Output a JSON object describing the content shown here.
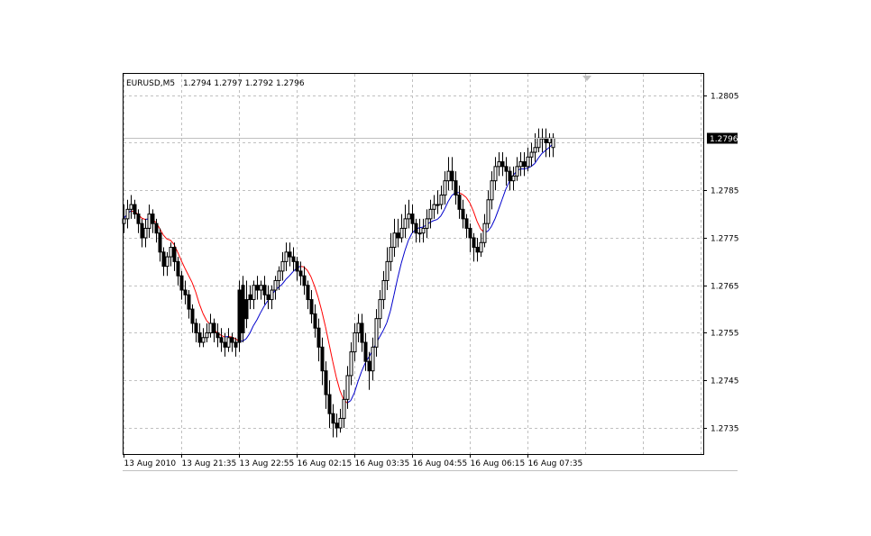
{
  "header": {
    "symbol": "EURUSD,M5",
    "ohlc": "1.2794 1.2797 1.2792 1.2796"
  },
  "current_price_label": "1.2796",
  "colors": {
    "background": "#ffffff",
    "grid": "#c0c0c0",
    "candle": "#000000",
    "ma_up": "#0000cc",
    "ma_down": "#ff0000",
    "marker": "#c0c0c0"
  },
  "chart_data": {
    "type": "candlestick",
    "title": "",
    "xlabel": "",
    "ylabel": "",
    "ylim": [
      1.27295,
      1.28095
    ],
    "grid": true,
    "y_ticks": [
      1.2735,
      1.2745,
      1.2755,
      1.2765,
      1.2775,
      1.2785,
      1.2795,
      1.2805
    ],
    "y_tick_labels": [
      "1.2735",
      "1.2745",
      "1.2755",
      "1.2765",
      "1.2775",
      "1.2785",
      "1.2805"
    ],
    "x_tick_labels": [
      "13 Aug 2010",
      "13 Aug 21:35",
      "13 Aug 22:55",
      "16 Aug 02:15",
      "16 Aug 03:35",
      "16 Aug 04:55",
      "16 Aug 06:15",
      "16 Aug 07:35"
    ],
    "x_tick_bars": [
      0,
      16,
      32,
      48,
      64,
      80,
      96,
      112
    ],
    "candles": {
      "close": [
        1.2779,
        1.2781,
        1.2782,
        1.278,
        1.2778,
        1.2775,
        1.2777,
        1.278,
        1.2778,
        1.2776,
        1.2772,
        1.2769,
        1.2771,
        1.2773,
        1.277,
        1.2767,
        1.2764,
        1.2763,
        1.276,
        1.2757,
        1.2755,
        1.2753,
        1.2754,
        1.2755,
        1.2757,
        1.2755,
        1.2754,
        1.2753,
        1.2752,
        1.2754,
        1.2753,
        1.2752,
        1.2753,
        1.2755,
        1.2758,
        1.2762,
        1.2765,
        1.2764,
        1.2765,
        1.2763,
        1.2762,
        1.2764,
        1.2766,
        1.2768,
        1.277,
        1.2772,
        1.2771,
        1.277,
        1.2768,
        1.2767,
        1.2765,
        1.2762,
        1.2759,
        1.2756,
        1.2752,
        1.2747,
        1.2742,
        1.2738,
        1.2736,
        1.2735,
        1.2737,
        1.2741,
        1.2746,
        1.2751,
        1.2755,
        1.2757,
        1.2753,
        1.2749,
        1.2747,
        1.2752,
        1.2758,
        1.2762,
        1.2766,
        1.277,
        1.2773,
        1.2776,
        1.2775,
        1.2777,
        1.2779,
        1.278,
        1.2778,
        1.2776,
        1.2776,
        1.2777,
        1.2779,
        1.2781,
        1.2782,
        1.2782,
        1.2784,
        1.2787,
        1.2789,
        1.2787,
        1.2784,
        1.2781,
        1.2779,
        1.2777,
        1.2775,
        1.2773,
        1.2772,
        1.2774,
        1.2778,
        1.2783,
        1.2787,
        1.279,
        1.2791,
        1.279,
        1.2789,
        1.2787,
        1.2788,
        1.279,
        1.2791,
        1.279,
        1.2792,
        1.2793,
        1.2794,
        1.2796,
        1.2796,
        1.2795,
        1.2796,
        1.2796
      ],
      "open": [
        1.2778,
        1.2779,
        1.2781,
        1.2782,
        1.278,
        1.2778,
        1.2775,
        1.2777,
        1.278,
        1.2778,
        1.2776,
        1.2772,
        1.2769,
        1.2771,
        1.2773,
        1.277,
        1.2767,
        1.2764,
        1.2763,
        1.276,
        1.2757,
        1.2755,
        1.2753,
        1.2754,
        1.2755,
        1.2757,
        1.2755,
        1.2754,
        1.2753,
        1.2752,
        1.2754,
        1.2753,
        1.2764,
        1.2765,
        1.2762,
        1.2763,
        1.2762,
        1.2765,
        1.2764,
        1.2765,
        1.2763,
        1.2762,
        1.2764,
        1.2766,
        1.2768,
        1.277,
        1.2772,
        1.2771,
        1.277,
        1.2768,
        1.2767,
        1.2765,
        1.2762,
        1.2759,
        1.2756,
        1.2752,
        1.2747,
        1.2742,
        1.2738,
        1.2736,
        1.2735,
        1.2737,
        1.2741,
        1.2746,
        1.2751,
        1.2755,
        1.2757,
        1.2753,
        1.2749,
        1.2747,
        1.2752,
        1.2758,
        1.2762,
        1.2766,
        1.277,
        1.2773,
        1.2776,
        1.2775,
        1.2777,
        1.2779,
        1.278,
        1.2778,
        1.2776,
        1.2776,
        1.2777,
        1.2779,
        1.2781,
        1.2782,
        1.2782,
        1.2784,
        1.2787,
        1.2789,
        1.2787,
        1.2784,
        1.2781,
        1.2779,
        1.2777,
        1.2775,
        1.2773,
        1.2772,
        1.2774,
        1.2778,
        1.2783,
        1.2787,
        1.279,
        1.2791,
        1.279,
        1.2789,
        1.2787,
        1.2788,
        1.279,
        1.2791,
        1.279,
        1.2792,
        1.2793,
        1.2794,
        1.2796,
        1.2796,
        1.2795,
        1.2794
      ],
      "high": [
        1.2782,
        1.2783,
        1.2784,
        1.2783,
        1.2781,
        1.2779,
        1.2779,
        1.2782,
        1.2781,
        1.2779,
        1.2777,
        1.2773,
        1.2772,
        1.2774,
        1.2774,
        1.2771,
        1.2768,
        1.2766,
        1.2764,
        1.2761,
        1.2758,
        1.2757,
        1.2756,
        1.2757,
        1.2759,
        1.2758,
        1.2757,
        1.2756,
        1.2755,
        1.2756,
        1.2755,
        1.2754,
        1.2766,
        1.2767,
        1.2766,
        1.2765,
        1.2766,
        1.2767,
        1.2766,
        1.2767,
        1.2765,
        1.2765,
        1.2767,
        1.2769,
        1.2772,
        1.2774,
        1.2774,
        1.2773,
        1.2771,
        1.277,
        1.2769,
        1.2766,
        1.2764,
        1.2761,
        1.2758,
        1.2754,
        1.2749,
        1.2745,
        1.274,
        1.2738,
        1.2739,
        1.2743,
        1.2748,
        1.2753,
        1.2757,
        1.2759,
        1.2759,
        1.2755,
        1.2751,
        1.2754,
        1.276,
        1.2764,
        1.2768,
        1.2773,
        1.2776,
        1.2779,
        1.2779,
        1.278,
        1.2782,
        1.2783,
        1.2782,
        1.2779,
        1.2779,
        1.2779,
        1.2781,
        1.2783,
        1.2784,
        1.2785,
        1.2786,
        1.2789,
        1.2792,
        1.2792,
        1.2789,
        1.2786,
        1.2783,
        1.278,
        1.2778,
        1.2776,
        1.2775,
        1.2776,
        1.278,
        1.2785,
        1.2789,
        1.2792,
        1.2793,
        1.2793,
        1.2792,
        1.279,
        1.279,
        1.2792,
        1.2793,
        1.2793,
        1.2794,
        1.2795,
        1.2797,
        1.2798,
        1.2798,
        1.2798,
        1.2797,
        1.2797
      ],
      "low": [
        1.2776,
        1.2777,
        1.2779,
        1.2779,
        1.2776,
        1.2773,
        1.2773,
        1.2775,
        1.2776,
        1.2774,
        1.277,
        1.2767,
        1.2767,
        1.2769,
        1.2768,
        1.2765,
        1.2762,
        1.2761,
        1.2758,
        1.2755,
        1.2753,
        1.2752,
        1.2752,
        1.2753,
        1.2754,
        1.2753,
        1.2752,
        1.2751,
        1.275,
        1.2751,
        1.2751,
        1.275,
        1.2751,
        1.2753,
        1.2756,
        1.276,
        1.276,
        1.2762,
        1.2762,
        1.2761,
        1.276,
        1.276,
        1.2762,
        1.2764,
        1.2766,
        1.2768,
        1.2769,
        1.2768,
        1.2766,
        1.2765,
        1.2763,
        1.276,
        1.2757,
        1.2754,
        1.2749,
        1.2744,
        1.2739,
        1.2735,
        1.2733,
        1.2733,
        1.2734,
        1.2735,
        1.2739,
        1.2744,
        1.2749,
        1.2753,
        1.2751,
        1.2747,
        1.2743,
        1.2745,
        1.275,
        1.2756,
        1.276,
        1.2764,
        1.2768,
        1.2771,
        1.2773,
        1.2774,
        1.2775,
        1.2777,
        1.2776,
        1.2774,
        1.2774,
        1.2774,
        1.2775,
        1.2777,
        1.2779,
        1.278,
        1.2781,
        1.2782,
        1.2785,
        1.2785,
        1.2782,
        1.2779,
        1.2777,
        1.2775,
        1.2772,
        1.277,
        1.277,
        1.2771,
        1.2773,
        1.2777,
        1.2781,
        1.2785,
        1.2788,
        1.2788,
        1.2786,
        1.2785,
        1.2785,
        1.2787,
        1.2788,
        1.2788,
        1.2789,
        1.279,
        1.2791,
        1.2793,
        1.2793,
        1.2792,
        1.2792,
        1.2792
      ]
    },
    "ma_period": 8
  }
}
